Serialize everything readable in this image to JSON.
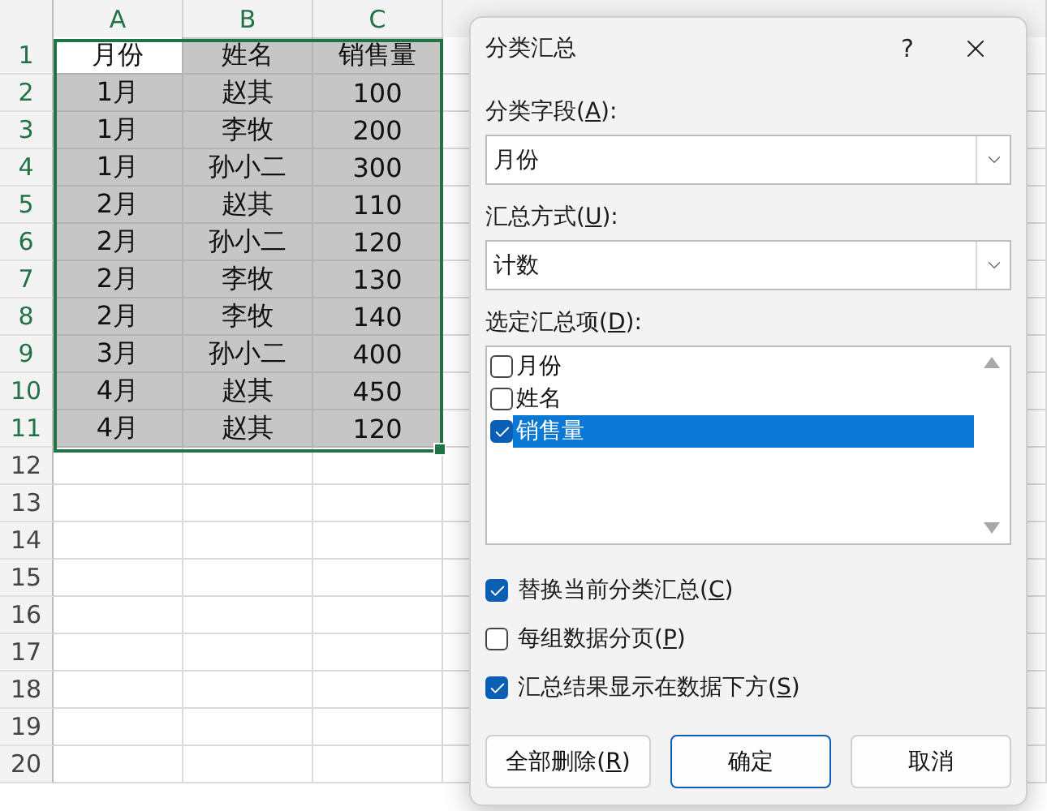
{
  "sheet": {
    "columns": [
      "A",
      "B",
      "C"
    ],
    "rows": [
      {
        "number": "1",
        "selected": true,
        "cells": [
          {
            "text": "月份",
            "active": true
          },
          {
            "text": "姓名",
            "active": false
          },
          {
            "text": "销售量",
            "active": false
          }
        ]
      },
      {
        "number": "2",
        "selected": true,
        "cells": [
          {
            "text": "1月",
            "active": false
          },
          {
            "text": "赵其",
            "active": false
          },
          {
            "text": "100",
            "active": false
          }
        ]
      },
      {
        "number": "3",
        "selected": true,
        "cells": [
          {
            "text": "1月",
            "active": false
          },
          {
            "text": "李牧",
            "active": false
          },
          {
            "text": "200",
            "active": false
          }
        ]
      },
      {
        "number": "4",
        "selected": true,
        "cells": [
          {
            "text": "1月",
            "active": false
          },
          {
            "text": "孙小二",
            "active": false
          },
          {
            "text": "300",
            "active": false
          }
        ]
      },
      {
        "number": "5",
        "selected": true,
        "cells": [
          {
            "text": "2月",
            "active": false
          },
          {
            "text": "赵其",
            "active": false
          },
          {
            "text": "110",
            "active": false
          }
        ]
      },
      {
        "number": "6",
        "selected": true,
        "cells": [
          {
            "text": "2月",
            "active": false
          },
          {
            "text": "孙小二",
            "active": false
          },
          {
            "text": "120",
            "active": false
          }
        ]
      },
      {
        "number": "7",
        "selected": true,
        "cells": [
          {
            "text": "2月",
            "active": false
          },
          {
            "text": "李牧",
            "active": false
          },
          {
            "text": "130",
            "active": false
          }
        ]
      },
      {
        "number": "8",
        "selected": true,
        "cells": [
          {
            "text": "2月",
            "active": false
          },
          {
            "text": "李牧",
            "active": false
          },
          {
            "text": "140",
            "active": false
          }
        ]
      },
      {
        "number": "9",
        "selected": true,
        "cells": [
          {
            "text": "3月",
            "active": false
          },
          {
            "text": "孙小二",
            "active": false
          },
          {
            "text": "400",
            "active": false
          }
        ]
      },
      {
        "number": "10",
        "selected": true,
        "cells": [
          {
            "text": "4月",
            "active": false
          },
          {
            "text": "赵其",
            "active": false
          },
          {
            "text": "450",
            "active": false
          }
        ]
      },
      {
        "number": "11",
        "selected": true,
        "cells": [
          {
            "text": "4月",
            "active": false
          },
          {
            "text": "赵其",
            "active": false
          },
          {
            "text": "120",
            "active": false
          }
        ]
      },
      {
        "number": "12",
        "selected": false
      },
      {
        "number": "13",
        "selected": false
      },
      {
        "number": "14",
        "selected": false
      },
      {
        "number": "15",
        "selected": false
      },
      {
        "number": "16",
        "selected": false
      },
      {
        "number": "17",
        "selected": false
      },
      {
        "number": "18",
        "selected": false
      },
      {
        "number": "19",
        "selected": false
      },
      {
        "number": "20",
        "selected": false
      }
    ]
  },
  "dialog": {
    "title": "分类汇总",
    "help_button": "?",
    "fields": [
      {
        "label": {
          "before": "分类字段(",
          "key": "A",
          "after": "):"
        },
        "value": "月份"
      },
      {
        "label": {
          "before": "汇总方式(",
          "key": "U",
          "after": "):"
        },
        "value": "计数"
      }
    ],
    "list_label": {
      "before": "选定汇总项(",
      "key": "D",
      "after": "):"
    },
    "list_items": [
      {
        "text": "月份",
        "checked": false,
        "selected": false
      },
      {
        "text": "姓名",
        "checked": false,
        "selected": false
      },
      {
        "text": "销售量",
        "checked": true,
        "selected": true
      }
    ],
    "options": [
      {
        "label": {
          "before": "替换当前分类汇总(",
          "key": "C",
          "after": ")"
        },
        "checked": true
      },
      {
        "label": {
          "before": "每组数据分页(",
          "key": "P",
          "after": ")"
        },
        "checked": false
      },
      {
        "label": {
          "before": "汇总结果显示在数据下方(",
          "key": "S",
          "after": ")"
        },
        "checked": true
      }
    ],
    "buttons": [
      {
        "label": {
          "before": "全部删除(",
          "key": "R",
          "after": ")"
        },
        "default": false
      },
      {
        "label": {
          "before": "确定"
        },
        "default": true
      },
      {
        "label": {
          "before": "取消"
        },
        "default": false
      }
    ]
  }
}
